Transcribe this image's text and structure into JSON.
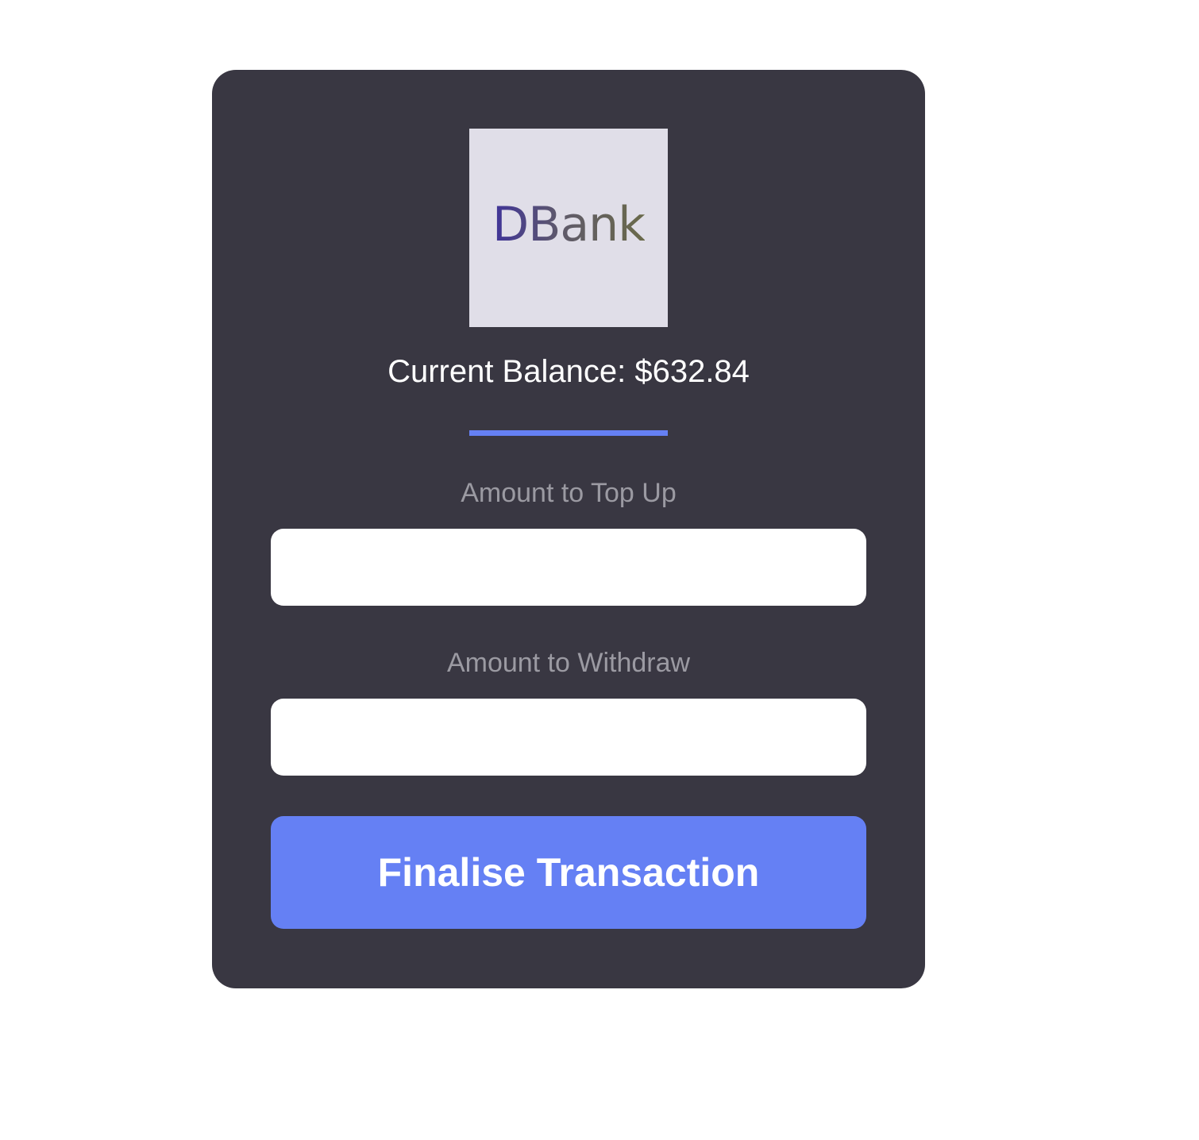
{
  "logo": {
    "text": "DBank"
  },
  "balance": {
    "text": "Current Balance: $632.84"
  },
  "form": {
    "topup_label": "Amount to Top Up",
    "topup_value": "",
    "withdraw_label": "Amount to Withdraw",
    "withdraw_value": "",
    "submit_label": "Finalise Transaction"
  },
  "colors": {
    "card_background": "#393742",
    "accent": "#6580f4",
    "logo_background": "#e0dee8",
    "label_text": "#9b9aa2"
  }
}
